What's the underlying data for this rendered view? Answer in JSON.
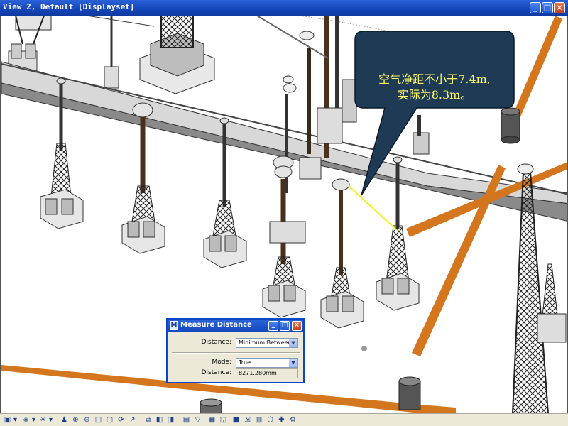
{
  "window": {
    "title": "View 2, Default [Displayset]",
    "min_glyph": "_",
    "max_glyph": "□",
    "close_glyph": "×"
  },
  "callout": {
    "line1": "空气净距不小于7.4m,",
    "line2": "实际为8.3m。",
    "fill_color": "#1f3a54",
    "text_color": "#ffff66"
  },
  "measure_dialog": {
    "title": "Measure Distance",
    "distance_label": "Distance:",
    "distance_mode_value": "Minimum Between",
    "mode_label": "Mode:",
    "mode_value": "True",
    "result_label": "Distance:",
    "result_value": "8271.280mm"
  },
  "colors": {
    "pipe": "#d4761e",
    "measure_line": "#f0f020",
    "structure": "#3a3a3a",
    "bus": "#bdbdbd"
  },
  "toolbar": {
    "icons": [
      "view-attributes-icon",
      "dropdown-icon",
      "levels-icon",
      "dropdown-icon",
      "light-icon",
      "dropdown-icon",
      "person-icon",
      "zoom-in-icon",
      "zoom-out-icon",
      "window-area-icon",
      "fit-view-icon",
      "rotate-icon",
      "pan-icon",
      "copy-view-icon",
      "view-previous-icon",
      "view-next-icon",
      "camera-icon",
      "clip-icon",
      "filter-icon",
      "render-icon",
      "shadow-icon",
      "walk-icon",
      "display-icon",
      "cube-icon",
      "axis-icon",
      "settings-icon",
      "help-icon"
    ]
  }
}
